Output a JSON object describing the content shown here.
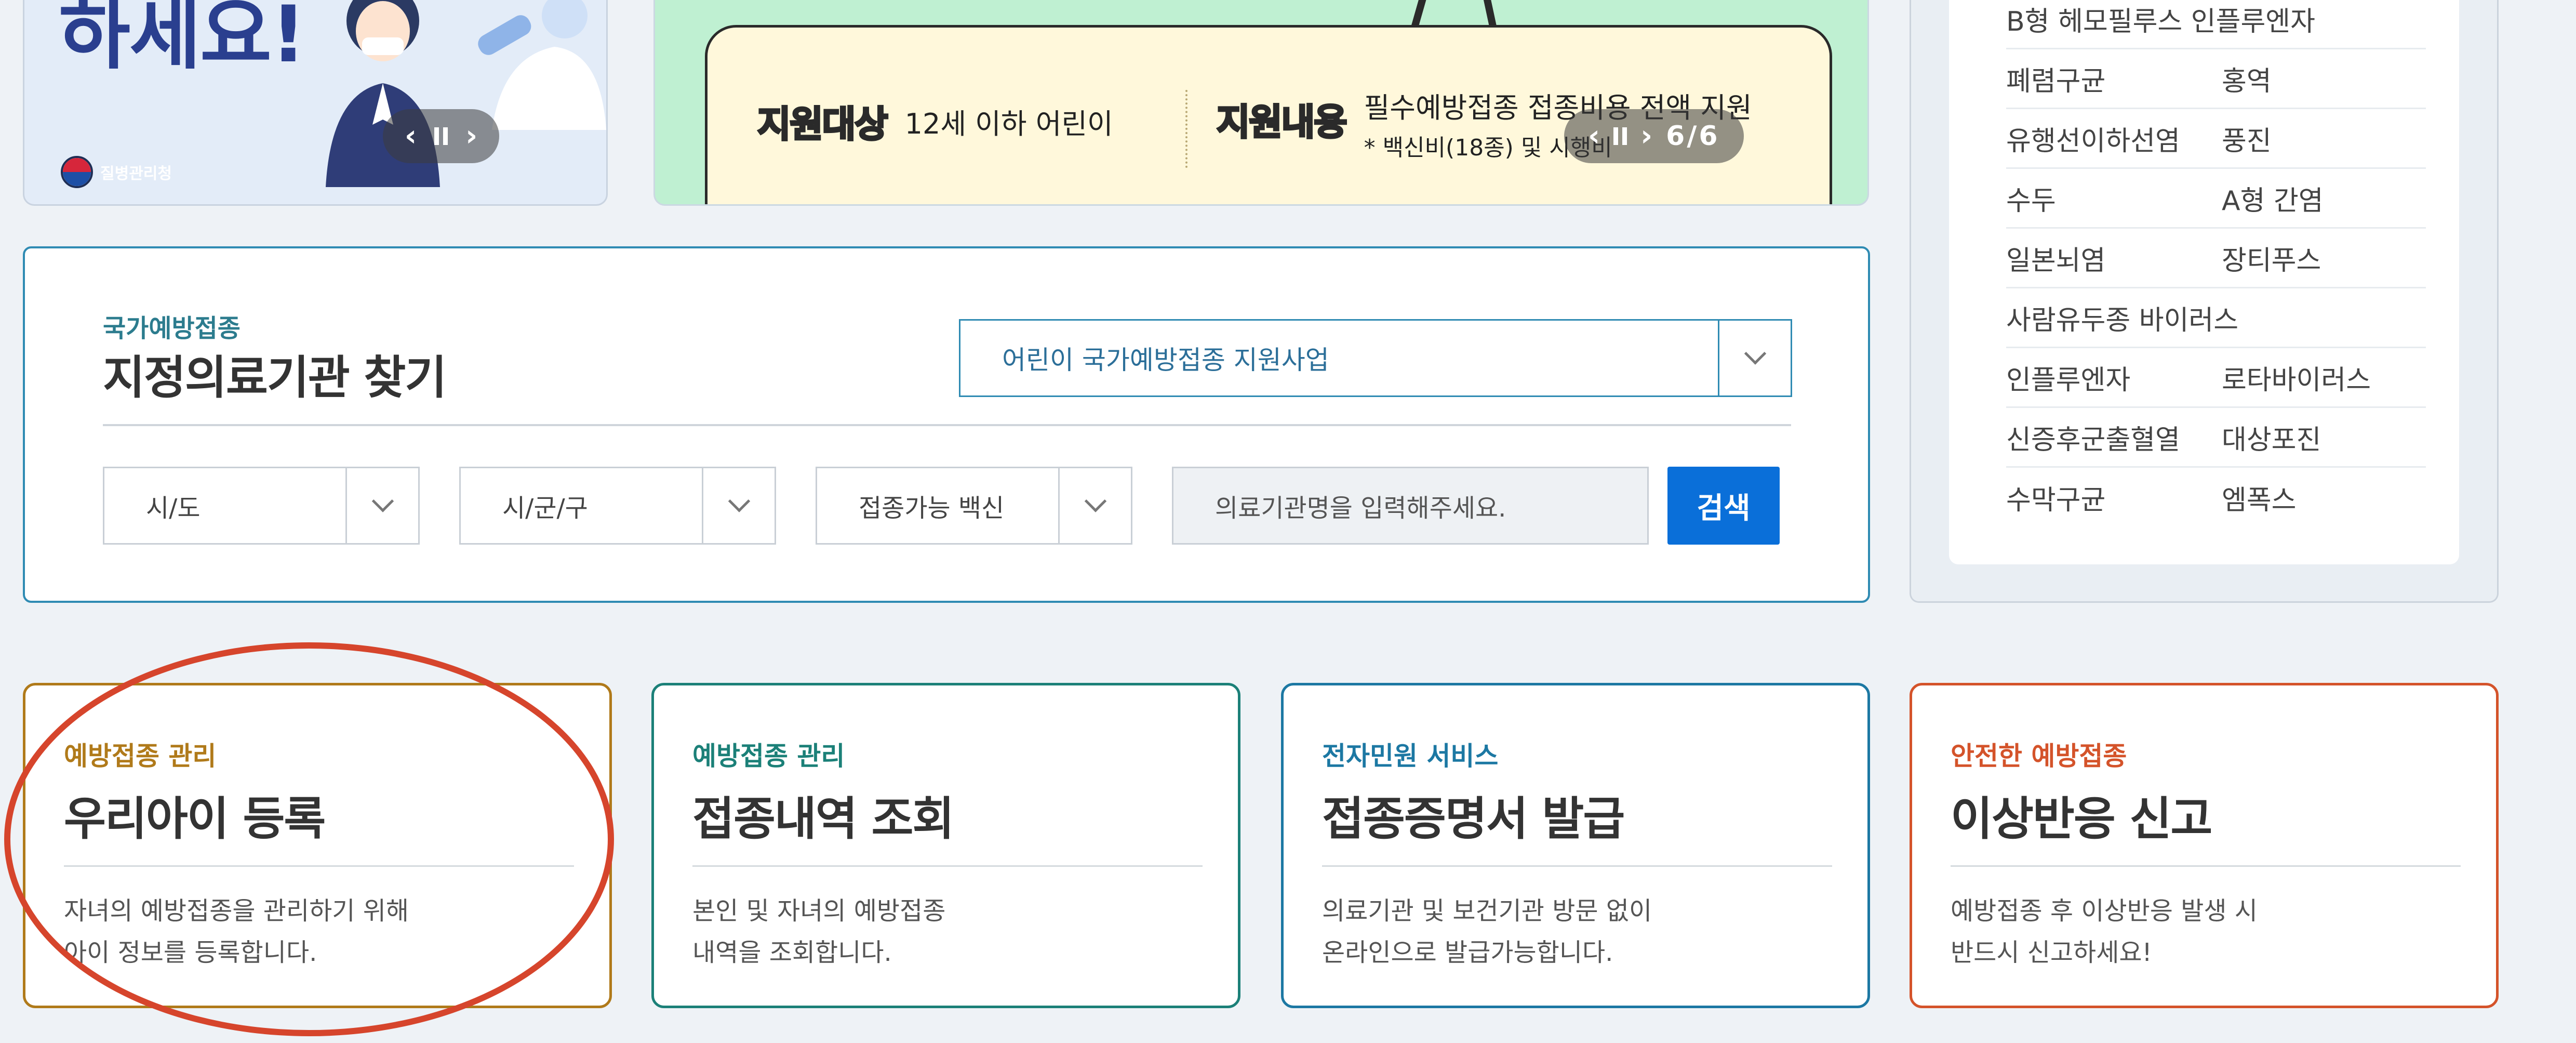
{
  "banner1": {
    "title": "하세요!",
    "logo_text": "질병관리청"
  },
  "banner2": {
    "target_tag": "지원대상",
    "target_text": "12세 이하 어린이",
    "content_tag": "지원내용",
    "content_text": "필수예방접종 접종비용 전액 지원",
    "content_note": "* 백신비(18종) 및 시행비",
    "slide_counter": "6/6"
  },
  "right_panel": {
    "rows": [
      {
        "c1": "B형 헤모필루스 인플루엔자",
        "c2": ""
      },
      {
        "c1": "폐렴구균",
        "c2": "홍역"
      },
      {
        "c1": "유행선이하선염",
        "c2": "풍진"
      },
      {
        "c1": "수두",
        "c2": "A형 간염"
      },
      {
        "c1": "일본뇌염",
        "c2": "장티푸스"
      },
      {
        "c1": "사람유두종 바이러스",
        "c2": ""
      },
      {
        "c1": "인플루엔자",
        "c2": "로타바이러스"
      },
      {
        "c1": "신증후군출혈열",
        "c2": "대상포진"
      },
      {
        "c1": "수막구균",
        "c2": "엠폭스"
      }
    ]
  },
  "search": {
    "subtitle": "국가예방접종",
    "title": "지정의료기관 찾기",
    "program_value": "어린이 국가예방접종 지원사업",
    "sido_value": "시/도",
    "sigungu_value": "시/군/구",
    "vaccine_value": "접종가능 백신",
    "input_placeholder": "의료기관명을 입력해주세요.",
    "search_label": "검색"
  },
  "cards": [
    {
      "category": "예방접종 관리",
      "title": "우리아이 등록",
      "desc": "자녀의 예방접종을 관리하기 위해\n아이 정보를 등록합니다.",
      "color": "#b07a1a"
    },
    {
      "category": "예방접종 관리",
      "title": "접종내역 조회",
      "desc": "본인 및 자녀의 예방접종\n내역을 조회합니다.",
      "color": "#1b8078"
    },
    {
      "category": "전자민원 서비스",
      "title": "접종증명서 발급",
      "desc": "의료기관 및 보건기관 방문 없이\n온라인으로 발급가능합니다.",
      "color": "#1c78a3"
    },
    {
      "category": "안전한 예방접종",
      "title": "이상반응 신고",
      "desc": "예방접종 후 이상반응 발생 시\n반드시 신고하세요!",
      "color": "#d4532a"
    }
  ],
  "colors": {
    "accent_blue": "#0a6fd9",
    "annotation_red": "#d6452c"
  }
}
